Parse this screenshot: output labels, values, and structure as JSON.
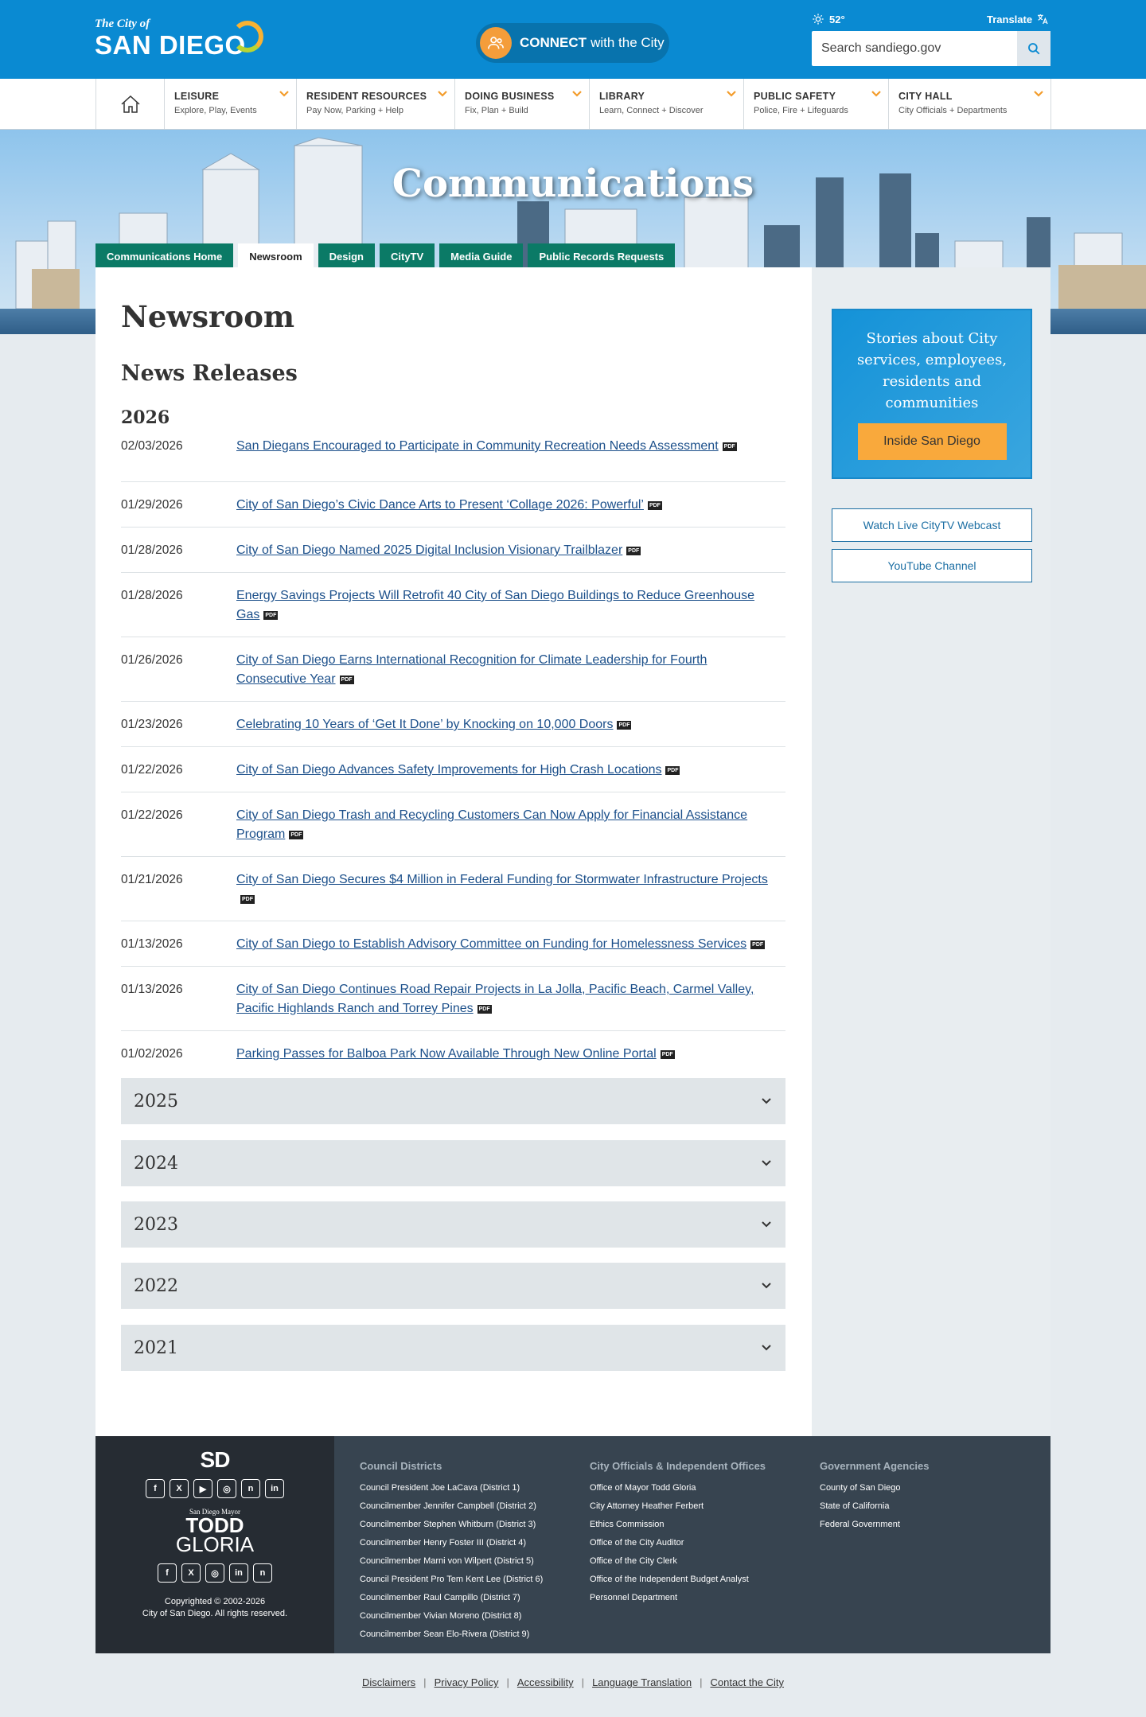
{
  "header": {
    "logo_line1": "The City of",
    "logo_line2": "SAN DIEGO",
    "connect_bold": "CONNECT",
    "connect_rest": "with the City",
    "weather": "52°",
    "translate": "Translate",
    "search_placeholder": "Search sandiego.gov"
  },
  "nav": [
    {
      "title": "LEISURE",
      "sub": "Explore, Play, Events"
    },
    {
      "title": "RESIDENT RESOURCES",
      "sub": "Pay Now, Parking + Help"
    },
    {
      "title": "DOING BUSINESS",
      "sub": "Fix, Plan + Build"
    },
    {
      "title": "LIBRARY",
      "sub": "Learn, Connect + Discover"
    },
    {
      "title": "PUBLIC SAFETY",
      "sub": "Police, Fire + Lifeguards"
    },
    {
      "title": "CITY HALL",
      "sub": "City Officials + Departments"
    }
  ],
  "hero_title": "Communications",
  "tabs": [
    "Communications Home",
    "Newsroom",
    "Design",
    "CityTV",
    "Media Guide",
    "Public Records Requests"
  ],
  "main": {
    "page_title": "Newsroom",
    "section_title": "News Releases",
    "year": "2026",
    "pdf_label": "PDF",
    "releases": [
      {
        "date": "02/03/2026",
        "title": "San Diegans Encouraged to Participate in Community Recreation Needs Assessment"
      },
      {
        "date": "01/29/2026",
        "title": "City of San Diego’s Civic Dance Arts to Present ‘Collage 2026: Powerful’"
      },
      {
        "date": "01/28/2026",
        "title": "City of San Diego Named 2025 Digital Inclusion Visionary Trailblazer"
      },
      {
        "date": "01/28/2026",
        "title": "Energy Savings Projects Will Retrofit 40 City of San Diego Buildings to Reduce Greenhouse Gas"
      },
      {
        "date": "01/26/2026",
        "title": "City of San Diego Earns International Recognition for Climate Leadership for Fourth Consecutive Year"
      },
      {
        "date": "01/23/2026",
        "title": "Celebrating 10 Years of ‘Get It Done’ by Knocking on 10,000 Doors"
      },
      {
        "date": "01/22/2026",
        "title": "City of San Diego Advances Safety Improvements for High Crash Locations"
      },
      {
        "date": "01/22/2026",
        "title": "City of San Diego Trash and Recycling Customers Can Now Apply for Financial Assistance Program"
      },
      {
        "date": "01/21/2026",
        "title": "City of San Diego Secures $4 Million in Federal Funding for Stormwater Infrastructure Projects"
      },
      {
        "date": "01/13/2026",
        "title": "City of San Diego to Establish Advisory Committee on Funding for Homelessness Services"
      },
      {
        "date": "01/13/2026",
        "title": "City of San Diego Continues Road Repair Projects in La Jolla, Pacific Beach, Carmel Valley, Pacific Highlands Ranch and Torrey Pines"
      },
      {
        "date": "01/02/2026",
        "title": "Parking Passes for Balboa Park Now Available Through New Online Portal"
      }
    ],
    "archive_years": [
      "2025",
      "2024",
      "2023",
      "2022",
      "2021"
    ]
  },
  "sidebar": {
    "promo_text": "Stories about City services, employees, residents and communities",
    "promo_button": "Inside San Diego",
    "button1": "Watch Live CityTV Webcast",
    "button2": "YouTube Channel"
  },
  "footer": {
    "sd_logo": "SD",
    "mayor_small": "San Diego Mayor",
    "mayor_line1": "TODD",
    "mayor_line2": "GLORIA",
    "copyright_line1": "Copyrighted © 2002-2026",
    "copyright_line2": "City of San Diego. All rights reserved.",
    "col1_title": "Council Districts",
    "col1_items": [
      "Council President Joe LaCava (District 1)",
      "Councilmember Jennifer Campbell (District 2)",
      "Councilmember Stephen Whitburn (District 3)",
      "Councilmember Henry Foster III (District 4)",
      "Councilmember Marni von Wilpert (District 5)",
      "Council President Pro Tem Kent Lee (District 6)",
      "Councilmember Raul Campillo (District 7)",
      "Councilmember Vivian Moreno (District 8)",
      "Councilmember Sean Elo-Rivera (District 9)"
    ],
    "col2_title": "City Officials & Independent Offices",
    "col2_items": [
      "Office of Mayor Todd Gloria",
      "City Attorney Heather Ferbert",
      "Ethics Commission",
      "Office of the City Auditor",
      "Office of the City Clerk",
      "Office of the Independent Budget Analyst",
      "Personnel Department"
    ],
    "col3_title": "Government Agencies",
    "col3_items": [
      "County of San Diego",
      "State of California",
      "Federal Government"
    ],
    "bottom_links": [
      "Disclaimers",
      "Privacy Policy",
      "Accessibility",
      "Language Translation",
      "Contact the City"
    ]
  },
  "colors": {
    "header_blue": "#0a8ad2",
    "tab_green": "#0b7a66",
    "promo_orange": "#f9a93c",
    "footer_dark": "#374450"
  },
  "icons": [
    "home-icon",
    "chevron-down-icon",
    "search-icon",
    "sun-icon",
    "translate-icon",
    "people-icon",
    "pdf-icon",
    "facebook-icon",
    "x-icon",
    "youtube-icon",
    "instagram-icon",
    "nextdoor-icon",
    "linkedin-icon"
  ]
}
